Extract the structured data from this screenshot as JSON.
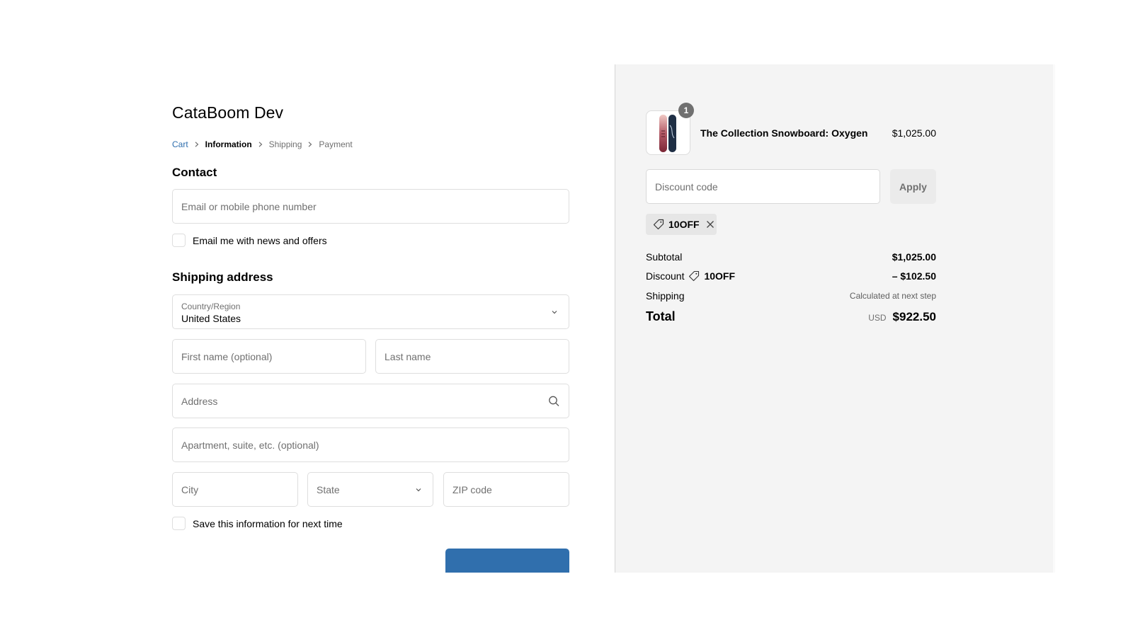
{
  "shop": {
    "title": "CataBoom Dev"
  },
  "breadcrumb": {
    "items": [
      {
        "label": "Cart",
        "state": "link"
      },
      {
        "label": "Information",
        "state": "active"
      },
      {
        "label": "Shipping",
        "state": "upcoming"
      },
      {
        "label": "Payment",
        "state": "upcoming"
      }
    ]
  },
  "contact": {
    "title": "Contact",
    "email_placeholder": "Email or mobile phone number",
    "newsletter_label": "Email me with news and offers",
    "newsletter_checked": false
  },
  "shipping": {
    "title": "Shipping address",
    "country_label": "Country/Region",
    "country_value": "United States",
    "first_name_placeholder": "First name (optional)",
    "last_name_placeholder": "Last name",
    "address_placeholder": "Address",
    "apartment_placeholder": "Apartment, suite, etc. (optional)",
    "city_placeholder": "City",
    "state_placeholder": "State",
    "zip_placeholder": "ZIP code",
    "save_info_label": "Save this information for next time",
    "save_info_checked": false
  },
  "summary": {
    "product": {
      "name": "The Collection Snowboard: Oxygen",
      "price": "$1,025.00",
      "quantity": "1"
    },
    "discount_placeholder": "Discount code",
    "apply_label": "Apply",
    "applied_code": "10OFF",
    "subtotal_label": "Subtotal",
    "subtotal_value": "$1,025.00",
    "discount_label": "Discount",
    "discount_code": "10OFF",
    "discount_value": "– $102.50",
    "shipping_label": "Shipping",
    "shipping_value": "Calculated at next step",
    "total_label": "Total",
    "currency": "USD",
    "total_value": "$922.50"
  },
  "colors": {
    "accent": "#306fad",
    "link": "#2f6ead",
    "summary_bg": "#f4f4f4"
  }
}
